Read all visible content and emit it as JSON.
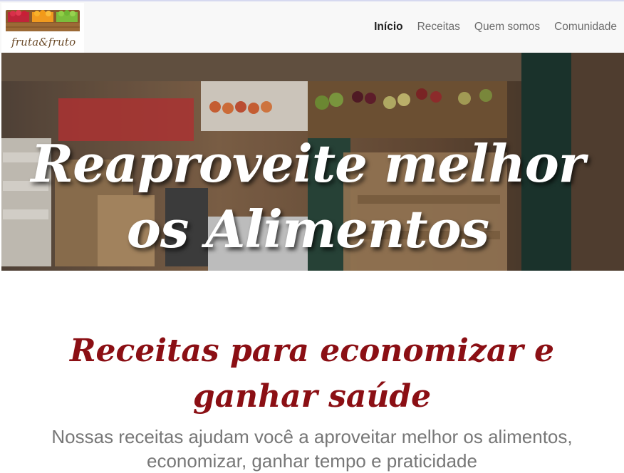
{
  "brand": {
    "logo_text": "fruta&fruto"
  },
  "nav": {
    "items": [
      {
        "label": "Início",
        "active": true
      },
      {
        "label": "Receitas",
        "active": false
      },
      {
        "label": "Quem somos",
        "active": false
      },
      {
        "label": "Comunidade",
        "active": false
      }
    ]
  },
  "hero": {
    "title": "Reaproveite melhor os Alimentos"
  },
  "section": {
    "title": "Receitas para economizar e ganhar saúde",
    "subtitle": "Nossas receitas ajudam você a aproveitar melhor os alimentos, economizar, ganhar tempo e praticidade"
  },
  "colors": {
    "section_title": "#8b0f14",
    "nav_bg": "#f8f8f8",
    "subtitle": "#777777"
  },
  "icons": {
    "logo": "fruit-crate-icon"
  }
}
